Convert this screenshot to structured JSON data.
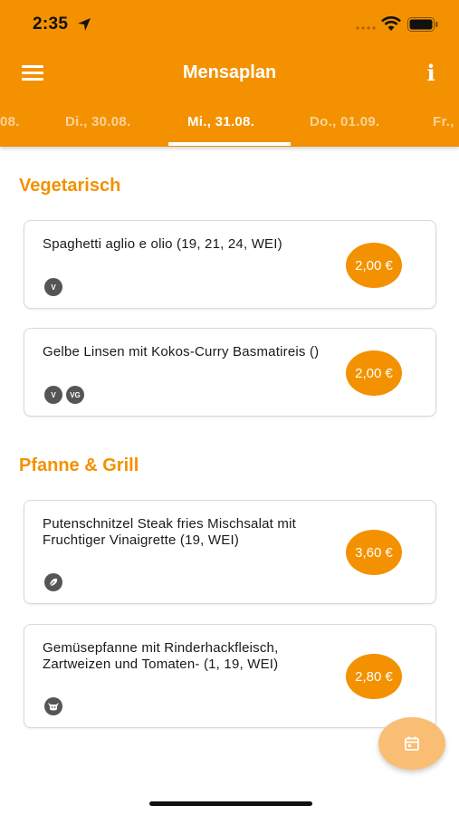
{
  "status_bar": {
    "time": "2:35"
  },
  "app_bar": {
    "title": "Mensaplan",
    "info_label": "i"
  },
  "date_tabs": [
    {
      "label": "08."
    },
    {
      "label": "Di., 30.08."
    },
    {
      "label": "Mi., 31.08.",
      "active": true
    },
    {
      "label": "Do., 01.09."
    },
    {
      "label": "Fr.,"
    }
  ],
  "sections": [
    {
      "title": "Vegetarisch",
      "meals": [
        {
          "name": "Spaghetti aglio e olio (19, 21, 24, WEI)",
          "price": "2,00 €",
          "badges": [
            "V"
          ]
        },
        {
          "name": "Gelbe Linsen mit Kokos-Curry Basmatireis ()",
          "price": "2,00 €",
          "badges": [
            "V",
            "VG"
          ]
        }
      ]
    },
    {
      "title": "Pfanne & Grill",
      "meals": [
        {
          "name": "Putenschnitzel Steak fries Mischsalat mit Fruchtiger Vinaigrette (19, WEI)",
          "price": "3,60 €",
          "badges": [
            "poultry-icon"
          ]
        },
        {
          "name": "Gemüsepfanne mit Rinderhackfleisch, Zartweizen und Tomaten- (1, 19, WEI)",
          "price": "2,80 €",
          "badges": [
            "beef-icon"
          ]
        }
      ]
    }
  ],
  "colors": {
    "primary": "#f39100",
    "fab": "#f9be73",
    "badge": "#555555"
  },
  "fab_icon": "calendar-icon"
}
